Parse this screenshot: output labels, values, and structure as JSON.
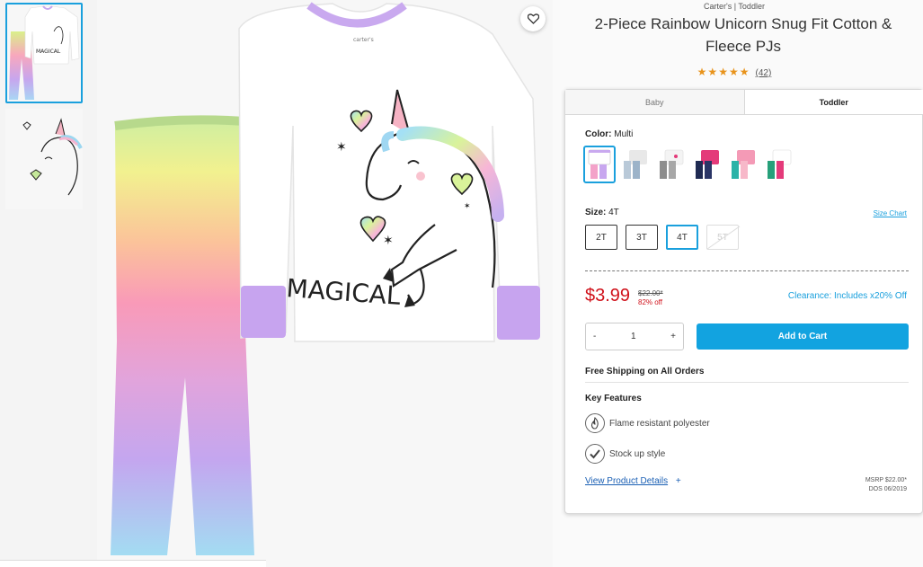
{
  "product": {
    "brand_line": "Carter's | Toddler",
    "title": "2-Piece Rainbow Unicorn Snug Fit Cotton & Fleece PJs",
    "stars": "★★★★★",
    "review_count": "(42)",
    "shirt_print": "MAGICAL",
    "shirt_tag": "carter's"
  },
  "tabs": [
    {
      "label": "Baby",
      "active": false
    },
    {
      "label": "Toddler",
      "active": true
    }
  ],
  "color": {
    "label": "Color:",
    "value": "Multi",
    "swatches": [
      {
        "name": "rainbow-unicorn",
        "top": "#ffffff",
        "bottom": "#f3a2c9",
        "selected": true
      },
      {
        "name": "grey-pattern",
        "top": "#e8e8e8",
        "bottom": "#b9c9d8",
        "selected": false
      },
      {
        "name": "grey-stripe",
        "top": "#f4f4f4",
        "bottom": "#8d8d8d",
        "selected": false
      },
      {
        "name": "navy-pink",
        "top": "#e43a7a",
        "bottom": "#1f2a52",
        "selected": false
      },
      {
        "name": "pink-teal",
        "top": "#f49ab6",
        "bottom": "#2bb3a8",
        "selected": false
      },
      {
        "name": "green-pink",
        "top": "#ffffff",
        "bottom": "#26a07a",
        "selected": false
      }
    ]
  },
  "size": {
    "label": "Size:",
    "value": "4T",
    "chart_link": "Size Chart",
    "options": [
      {
        "label": "2T",
        "state": "normal"
      },
      {
        "label": "3T",
        "state": "normal"
      },
      {
        "label": "4T",
        "state": "selected"
      },
      {
        "label": "5T",
        "state": "disabled"
      }
    ]
  },
  "pricing": {
    "price": "$3.99",
    "was": "$22.00*",
    "percent_off": "82% off",
    "clearance": "Clearance: Includes x20% Off"
  },
  "purchase": {
    "minus": "-",
    "qty": "1",
    "plus": "+",
    "add_to_cart": "Add to Cart"
  },
  "shipping": "Free Shipping on All Orders",
  "features": {
    "heading": "Key Features",
    "items": [
      {
        "icon": "flame-icon",
        "label": "Flame resistant polyester"
      },
      {
        "icon": "checkmark-icon",
        "label": "Stock up style"
      }
    ]
  },
  "details": {
    "link": "View Product Details",
    "plus": "+",
    "msrp": "MSRP $22.00*",
    "dos": "DOS 06/2019"
  },
  "colors": {
    "accent": "#1aa0dd",
    "cart_button": "#12a3e0",
    "price_red": "#d0121b",
    "star_orange": "#e8931b"
  }
}
